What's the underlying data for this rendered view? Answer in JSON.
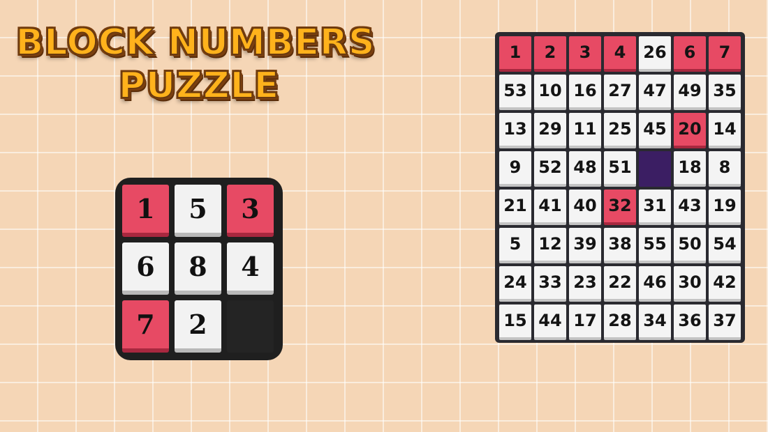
{
  "title": {
    "line1": "BLOCK NUMBERS",
    "line2": "PUZZLE"
  },
  "colors": {
    "background": "#f5d6b6",
    "tile_pink": "#e74a64",
    "tile_white": "#f4f4f4",
    "empty_small": "#242424",
    "empty_large": "#3b1e63",
    "title_yellow": "#ffb21c"
  },
  "small_puzzle": {
    "tiles": [
      {
        "label": "1",
        "color": "pink"
      },
      {
        "label": "5",
        "color": "white"
      },
      {
        "label": "3",
        "color": "pink"
      },
      {
        "label": "6",
        "color": "white"
      },
      {
        "label": "8",
        "color": "white"
      },
      {
        "label": "4",
        "color": "white"
      },
      {
        "label": "7",
        "color": "pink"
      },
      {
        "label": "2",
        "color": "white"
      },
      {
        "label": "",
        "color": "empty"
      }
    ]
  },
  "large_puzzle": {
    "tiles": [
      {
        "label": "1",
        "color": "pink"
      },
      {
        "label": "2",
        "color": "pink"
      },
      {
        "label": "3",
        "color": "pink"
      },
      {
        "label": "4",
        "color": "pink"
      },
      {
        "label": "26",
        "color": "white"
      },
      {
        "label": "6",
        "color": "pink"
      },
      {
        "label": "7",
        "color": "pink"
      },
      {
        "label": "53",
        "color": "white"
      },
      {
        "label": "10",
        "color": "white"
      },
      {
        "label": "16",
        "color": "white"
      },
      {
        "label": "27",
        "color": "white"
      },
      {
        "label": "47",
        "color": "white"
      },
      {
        "label": "49",
        "color": "white"
      },
      {
        "label": "35",
        "color": "white"
      },
      {
        "label": "13",
        "color": "white"
      },
      {
        "label": "29",
        "color": "white"
      },
      {
        "label": "11",
        "color": "white"
      },
      {
        "label": "25",
        "color": "white"
      },
      {
        "label": "45",
        "color": "white"
      },
      {
        "label": "20",
        "color": "pink"
      },
      {
        "label": "14",
        "color": "white"
      },
      {
        "label": "9",
        "color": "white"
      },
      {
        "label": "52",
        "color": "white"
      },
      {
        "label": "48",
        "color": "white"
      },
      {
        "label": "51",
        "color": "white"
      },
      {
        "label": "",
        "color": "empty"
      },
      {
        "label": "18",
        "color": "white"
      },
      {
        "label": "8",
        "color": "white"
      },
      {
        "label": "21",
        "color": "white"
      },
      {
        "label": "41",
        "color": "white"
      },
      {
        "label": "40",
        "color": "white"
      },
      {
        "label": "32",
        "color": "pink"
      },
      {
        "label": "31",
        "color": "white"
      },
      {
        "label": "43",
        "color": "white"
      },
      {
        "label": "19",
        "color": "white"
      },
      {
        "label": "5",
        "color": "white"
      },
      {
        "label": "12",
        "color": "white"
      },
      {
        "label": "39",
        "color": "white"
      },
      {
        "label": "38",
        "color": "white"
      },
      {
        "label": "55",
        "color": "white"
      },
      {
        "label": "50",
        "color": "white"
      },
      {
        "label": "54",
        "color": "white"
      },
      {
        "label": "24",
        "color": "white"
      },
      {
        "label": "33",
        "color": "white"
      },
      {
        "label": "23",
        "color": "white"
      },
      {
        "label": "22",
        "color": "white"
      },
      {
        "label": "46",
        "color": "white"
      },
      {
        "label": "30",
        "color": "white"
      },
      {
        "label": "42",
        "color": "white"
      },
      {
        "label": "15",
        "color": "white"
      },
      {
        "label": "44",
        "color": "white"
      },
      {
        "label": "17",
        "color": "white"
      },
      {
        "label": "28",
        "color": "white"
      },
      {
        "label": "34",
        "color": "white"
      },
      {
        "label": "36",
        "color": "white"
      },
      {
        "label": "37",
        "color": "white"
      }
    ]
  }
}
